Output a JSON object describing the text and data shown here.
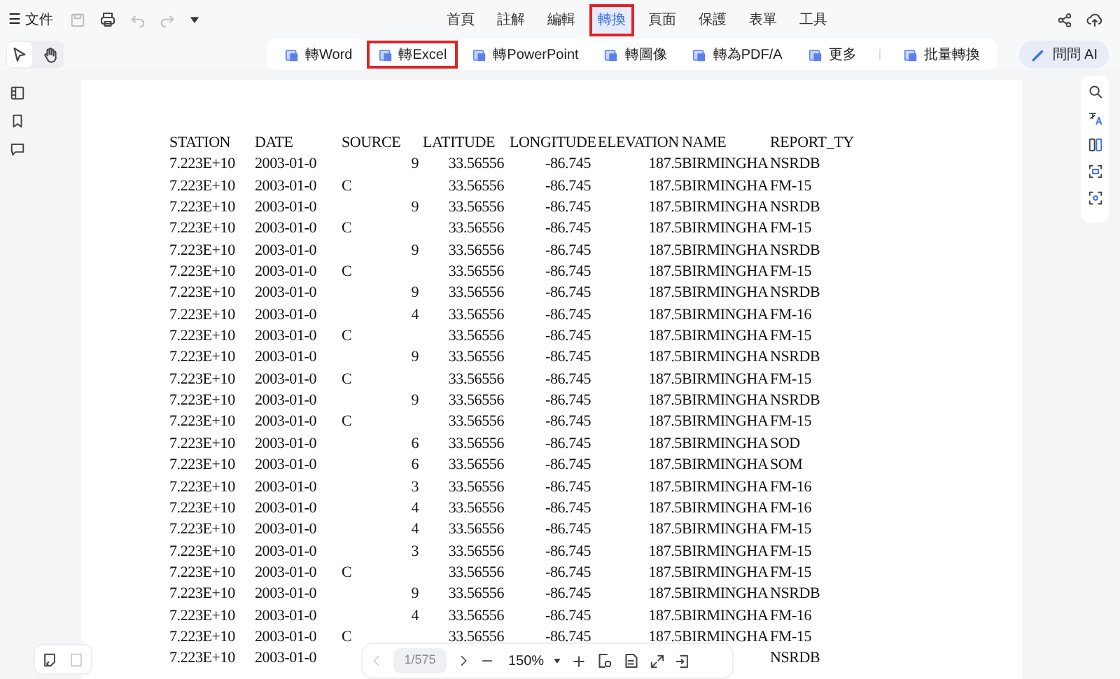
{
  "file_menu": {
    "icon": "☰",
    "label": "文件"
  },
  "menu": [
    {
      "label": "首頁",
      "selected": false,
      "highlighted": false
    },
    {
      "label": "註解",
      "selected": false,
      "highlighted": false
    },
    {
      "label": "編輯",
      "selected": false,
      "highlighted": false
    },
    {
      "label": "轉換",
      "selected": true,
      "highlighted": true
    },
    {
      "label": "頁面",
      "selected": false,
      "highlighted": false
    },
    {
      "label": "保護",
      "selected": false,
      "highlighted": false
    },
    {
      "label": "表單",
      "selected": false,
      "highlighted": false
    },
    {
      "label": "工具",
      "selected": false,
      "highlighted": false
    }
  ],
  "tools": [
    {
      "kind": "select",
      "selected": true
    },
    {
      "kind": "hand",
      "selected": false
    }
  ],
  "convert_bar": [
    {
      "label": "轉Word",
      "highlighted": false
    },
    {
      "label": "轉Excel",
      "highlighted": true
    },
    {
      "label": "轉PowerPoint",
      "highlighted": false
    },
    {
      "label": "轉圖像",
      "highlighted": false
    },
    {
      "label": "轉為PDF/A",
      "highlighted": false
    },
    {
      "label": "更多",
      "highlighted": false
    },
    {
      "label": "批量轉換",
      "highlighted": false
    }
  ],
  "ai_button": {
    "label": "問問 AI"
  },
  "document": {
    "columns": [
      "STATION",
      "DATE",
      "SOURCE",
      "LATITUDE",
      "LONGITUDE",
      "ELEVATION",
      "NAME",
      "REPORT_TY"
    ],
    "rows": [
      {
        "station": "7.223E+10",
        "date": "2003-01-0",
        "source": "9",
        "latitude": "33.56556",
        "longitude": "-86.745",
        "elevation": "187.5",
        "name": "BIRMINGHA",
        "report_type": "NSRDB"
      },
      {
        "station": "7.223E+10",
        "date": "2003-01-0",
        "source": "C",
        "latitude": "33.56556",
        "longitude": "-86.745",
        "elevation": "187.5",
        "name": "BIRMINGHA",
        "report_type": "FM-15"
      },
      {
        "station": "7.223E+10",
        "date": "2003-01-0",
        "source": "9",
        "latitude": "33.56556",
        "longitude": "-86.745",
        "elevation": "187.5",
        "name": "BIRMINGHA",
        "report_type": "NSRDB"
      },
      {
        "station": "7.223E+10",
        "date": "2003-01-0",
        "source": "C",
        "latitude": "33.56556",
        "longitude": "-86.745",
        "elevation": "187.5",
        "name": "BIRMINGHA",
        "report_type": "FM-15"
      },
      {
        "station": "7.223E+10",
        "date": "2003-01-0",
        "source": "9",
        "latitude": "33.56556",
        "longitude": "-86.745",
        "elevation": "187.5",
        "name": "BIRMINGHA",
        "report_type": "NSRDB"
      },
      {
        "station": "7.223E+10",
        "date": "2003-01-0",
        "source": "C",
        "latitude": "33.56556",
        "longitude": "-86.745",
        "elevation": "187.5",
        "name": "BIRMINGHA",
        "report_type": "FM-15"
      },
      {
        "station": "7.223E+10",
        "date": "2003-01-0",
        "source": "9",
        "latitude": "33.56556",
        "longitude": "-86.745",
        "elevation": "187.5",
        "name": "BIRMINGHA",
        "report_type": "NSRDB"
      },
      {
        "station": "7.223E+10",
        "date": "2003-01-0",
        "source": "4",
        "latitude": "33.56556",
        "longitude": "-86.745",
        "elevation": "187.5",
        "name": "BIRMINGHA",
        "report_type": "FM-16"
      },
      {
        "station": "7.223E+10",
        "date": "2003-01-0",
        "source": "C",
        "latitude": "33.56556",
        "longitude": "-86.745",
        "elevation": "187.5",
        "name": "BIRMINGHA",
        "report_type": "FM-15"
      },
      {
        "station": "7.223E+10",
        "date": "2003-01-0",
        "source": "9",
        "latitude": "33.56556",
        "longitude": "-86.745",
        "elevation": "187.5",
        "name": "BIRMINGHA",
        "report_type": "NSRDB"
      },
      {
        "station": "7.223E+10",
        "date": "2003-01-0",
        "source": "C",
        "latitude": "33.56556",
        "longitude": "-86.745",
        "elevation": "187.5",
        "name": "BIRMINGHA",
        "report_type": "FM-15"
      },
      {
        "station": "7.223E+10",
        "date": "2003-01-0",
        "source": "9",
        "latitude": "33.56556",
        "longitude": "-86.745",
        "elevation": "187.5",
        "name": "BIRMINGHA",
        "report_type": "NSRDB"
      },
      {
        "station": "7.223E+10",
        "date": "2003-01-0",
        "source": "C",
        "latitude": "33.56556",
        "longitude": "-86.745",
        "elevation": "187.5",
        "name": "BIRMINGHA",
        "report_type": "FM-15"
      },
      {
        "station": "7.223E+10",
        "date": "2003-01-0",
        "source": "6",
        "latitude": "33.56556",
        "longitude": "-86.745",
        "elevation": "187.5",
        "name": "BIRMINGHA",
        "report_type": "SOD"
      },
      {
        "station": "7.223E+10",
        "date": "2003-01-0",
        "source": "6",
        "latitude": "33.56556",
        "longitude": "-86.745",
        "elevation": "187.5",
        "name": "BIRMINGHA",
        "report_type": "SOM"
      },
      {
        "station": "7.223E+10",
        "date": "2003-01-0",
        "source": "3",
        "latitude": "33.56556",
        "longitude": "-86.745",
        "elevation": "187.5",
        "name": "BIRMINGHA",
        "report_type": "FM-16"
      },
      {
        "station": "7.223E+10",
        "date": "2003-01-0",
        "source": "4",
        "latitude": "33.56556",
        "longitude": "-86.745",
        "elevation": "187.5",
        "name": "BIRMINGHA",
        "report_type": "FM-16"
      },
      {
        "station": "7.223E+10",
        "date": "2003-01-0",
        "source": "4",
        "latitude": "33.56556",
        "longitude": "-86.745",
        "elevation": "187.5",
        "name": "BIRMINGHA",
        "report_type": "FM-15"
      },
      {
        "station": "7.223E+10",
        "date": "2003-01-0",
        "source": "3",
        "latitude": "33.56556",
        "longitude": "-86.745",
        "elevation": "187.5",
        "name": "BIRMINGHA",
        "report_type": "FM-15"
      },
      {
        "station": "7.223E+10",
        "date": "2003-01-0",
        "source": "C",
        "latitude": "33.56556",
        "longitude": "-86.745",
        "elevation": "187.5",
        "name": "BIRMINGHA",
        "report_type": "FM-15"
      },
      {
        "station": "7.223E+10",
        "date": "2003-01-0",
        "source": "9",
        "latitude": "33.56556",
        "longitude": "-86.745",
        "elevation": "187.5",
        "name": "BIRMINGHA",
        "report_type": "NSRDB"
      },
      {
        "station": "7.223E+10",
        "date": "2003-01-0",
        "source": "4",
        "latitude": "33.56556",
        "longitude": "-86.745",
        "elevation": "187.5",
        "name": "BIRMINGHA",
        "report_type": "FM-16"
      },
      {
        "station": "7.223E+10",
        "date": "2003-01-0",
        "source": "C",
        "latitude": "33.56556",
        "longitude": "-86.745",
        "elevation": "187.5",
        "name": "BIRMINGHA",
        "report_type": "FM-15"
      },
      {
        "station": "7.223E+10",
        "date": "2003-01-0",
        "report_type": "NSRDB"
      }
    ]
  },
  "page_nav": {
    "page": "1/575",
    "zoom": "150%"
  }
}
